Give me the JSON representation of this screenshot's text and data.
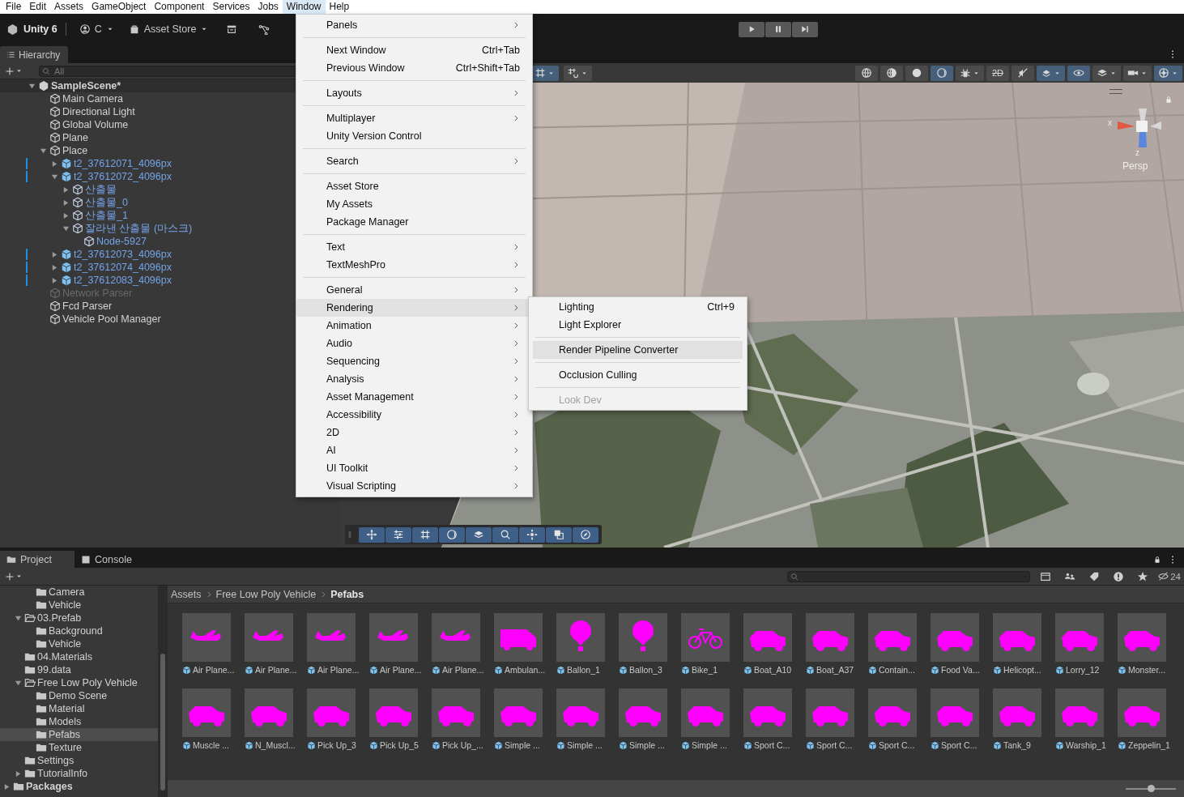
{
  "menubar": [
    {
      "label": "File",
      "selected": false
    },
    {
      "label": "Edit",
      "selected": false
    },
    {
      "label": "Assets",
      "selected": false
    },
    {
      "label": "GameObject",
      "selected": false
    },
    {
      "label": "Component",
      "selected": false
    },
    {
      "label": "Services",
      "selected": false
    },
    {
      "label": "Jobs",
      "selected": false
    },
    {
      "label": "Window",
      "selected": true
    },
    {
      "label": "Help",
      "selected": false
    }
  ],
  "toolbar": {
    "product": "Unity 6",
    "account": "C",
    "store": "Asset Store",
    "playback": [
      {
        "kind": "play",
        "selected": false
      },
      {
        "kind": "pause",
        "selected": false
      },
      {
        "kind": "step",
        "selected": false
      }
    ]
  },
  "hierarchy": {
    "title": "Hierarchy",
    "search": {
      "placeholder": "All"
    },
    "tree": [
      {
        "label": "SampleScene*",
        "kind": "scene",
        "expanded": true,
        "children": [
          {
            "label": "Main Camera",
            "kind": "object"
          },
          {
            "label": "Directional Light",
            "kind": "object"
          },
          {
            "label": "Global Volume",
            "kind": "object"
          },
          {
            "label": "Plane",
            "kind": "object"
          },
          {
            "label": "Place",
            "kind": "object",
            "expanded": true,
            "children": [
              {
                "label": "t2_37612071_4096px",
                "kind": "prefab",
                "expanded": false
              },
              {
                "label": "t2_37612072_4096px",
                "kind": "prefab",
                "expanded": true,
                "children": [
                  {
                    "label": "산출물",
                    "kind": "prefab-part",
                    "expanded": false
                  },
                  {
                    "label": "산출물_0",
                    "kind": "prefab-part",
                    "expanded": false
                  },
                  {
                    "label": "산출물_1",
                    "kind": "prefab-part",
                    "expanded": false
                  },
                  {
                    "label": "잘라낸 산출물 (마스크)",
                    "kind": "prefab-part",
                    "expanded": true,
                    "children": [
                      {
                        "label": "Node-5927",
                        "kind": "prefab-part"
                      }
                    ]
                  }
                ]
              },
              {
                "label": "t2_37612073_4096px",
                "kind": "prefab",
                "expanded": false
              },
              {
                "label": "t2_37612074_4096px",
                "kind": "prefab",
                "expanded": false
              },
              {
                "label": "t2_37612083_4096px",
                "kind": "prefab",
                "expanded": false
              }
            ]
          },
          {
            "label": "Network Parser",
            "kind": "inactive"
          },
          {
            "label": "Fcd Parser",
            "kind": "object"
          },
          {
            "label": "Vehicle Pool Manager",
            "kind": "object"
          }
        ]
      }
    ]
  },
  "scene": {
    "tools_left": [
      {
        "kind": "grid",
        "selected": true
      },
      {
        "kind": "snap",
        "selected": false
      }
    ],
    "tools_right": [
      {
        "kind": "globe",
        "selected": false
      },
      {
        "kind": "globe-half",
        "selected": false
      },
      {
        "kind": "sphere",
        "selected": false
      },
      {
        "kind": "moon",
        "selected": true
      },
      {
        "kind": "bug",
        "selected": false,
        "dropdown": true
      },
      {
        "kind": "label",
        "label": "2D",
        "selected": false
      },
      {
        "kind": "mute",
        "selected": false
      },
      {
        "kind": "effects",
        "selected": true,
        "dropdown": true
      },
      {
        "kind": "eye",
        "selected": true
      },
      {
        "kind": "layers",
        "selected": false,
        "dropdown": true
      },
      {
        "kind": "camera",
        "selected": false,
        "dropdown": true
      },
      {
        "kind": "gizmo",
        "selected": true,
        "dropdown": true
      }
    ],
    "gizmo": {
      "x_label": "x",
      "z_label": "z",
      "view": "Persp"
    },
    "overlay_tools": [
      {
        "kind": "move"
      },
      {
        "kind": "sliders"
      },
      {
        "kind": "grid"
      },
      {
        "kind": "moon"
      },
      {
        "kind": "layers"
      },
      {
        "kind": "search"
      },
      {
        "kind": "nodes"
      },
      {
        "kind": "stack"
      },
      {
        "kind": "compass"
      }
    ]
  },
  "window_menu": {
    "items": [
      {
        "kind": "item",
        "label": "Panels",
        "submenu": true,
        "selected": false
      },
      {
        "kind": "separator"
      },
      {
        "kind": "item",
        "label": "Next Window",
        "shortcut": "Ctrl+Tab",
        "submenu": false,
        "selected": false
      },
      {
        "kind": "item",
        "label": "Previous Window",
        "shortcut": "Ctrl+Shift+Tab",
        "submenu": false,
        "selected": false
      },
      {
        "kind": "separator"
      },
      {
        "kind": "item",
        "label": "Layouts",
        "submenu": true,
        "selected": false
      },
      {
        "kind": "separator"
      },
      {
        "kind": "item",
        "label": "Multiplayer",
        "submenu": true,
        "selected": false
      },
      {
        "kind": "item",
        "label": "Unity Version Control",
        "submenu": false,
        "selected": false
      },
      {
        "kind": "separator"
      },
      {
        "kind": "item",
        "label": "Search",
        "submenu": true,
        "selected": false
      },
      {
        "kind": "separator"
      },
      {
        "kind": "item",
        "label": "Asset Store",
        "submenu": false,
        "selected": false
      },
      {
        "kind": "item",
        "label": "My Assets",
        "submenu": false,
        "selected": false
      },
      {
        "kind": "item",
        "label": "Package Manager",
        "submenu": false,
        "selected": false
      },
      {
        "kind": "separator"
      },
      {
        "kind": "item",
        "label": "Text",
        "submenu": true,
        "selected": false
      },
      {
        "kind": "item",
        "label": "TextMeshPro",
        "submenu": true,
        "selected": false
      },
      {
        "kind": "separator"
      },
      {
        "kind": "item",
        "label": "General",
        "submenu": true,
        "selected": false
      },
      {
        "kind": "item",
        "label": "Rendering",
        "submenu": true,
        "selected": true
      },
      {
        "kind": "item",
        "label": "Animation",
        "submenu": true,
        "selected": false
      },
      {
        "kind": "item",
        "label": "Audio",
        "submenu": true,
        "selected": false
      },
      {
        "kind": "item",
        "label": "Sequencing",
        "submenu": true,
        "selected": false
      },
      {
        "kind": "item",
        "label": "Analysis",
        "submenu": true,
        "selected": false
      },
      {
        "kind": "item",
        "label": "Asset Management",
        "submenu": true,
        "selected": false
      },
      {
        "kind": "item",
        "label": "Accessibility",
        "submenu": true,
        "selected": false
      },
      {
        "kind": "item",
        "label": "2D",
        "submenu": true,
        "selected": false
      },
      {
        "kind": "item",
        "label": "AI",
        "submenu": true,
        "selected": false
      },
      {
        "kind": "item",
        "label": "UI Toolkit",
        "submenu": true,
        "selected": false
      },
      {
        "kind": "item",
        "label": "Visual Scripting",
        "submenu": true,
        "selected": false
      }
    ]
  },
  "rendering_submenu": {
    "items": [
      {
        "kind": "item",
        "label": "Lighting",
        "shortcut": "Ctrl+9",
        "selected": false,
        "disabled": false
      },
      {
        "kind": "item",
        "label": "Light Explorer",
        "selected": false,
        "disabled": false
      },
      {
        "kind": "separator"
      },
      {
        "kind": "item",
        "label": "Render Pipeline Converter",
        "selected": true,
        "disabled": false
      },
      {
        "kind": "separator"
      },
      {
        "kind": "item",
        "label": "Occlusion Culling",
        "selected": false,
        "disabled": false
      },
      {
        "kind": "separator"
      },
      {
        "kind": "item",
        "label": "Look Dev",
        "selected": false,
        "disabled": true
      }
    ]
  },
  "project": {
    "tabs": [
      {
        "label": "Project",
        "kind": "folder",
        "selected": true
      },
      {
        "label": "Console",
        "kind": "console",
        "selected": false
      }
    ],
    "tree": [
      {
        "children": [
          {
            "children": [
              {
                "label": "Camera"
              },
              {
                "label": "Vehicle"
              }
            ]
          },
          {
            "label": "03.Prefab",
            "expanded": true,
            "children": [
              {
                "label": "Background"
              },
              {
                "label": "Vehicle"
              }
            ]
          },
          {
            "label": "04.Materials"
          },
          {
            "label": "99.data"
          },
          {
            "label": "Free Low Poly Vehicle",
            "expanded": true,
            "children": [
              {
                "label": "Demo Scene"
              },
              {
                "label": "Material"
              },
              {
                "label": "Models"
              },
              {
                "label": "Pefabs",
                "selected": true
              },
              {
                "label": "Texture"
              }
            ]
          },
          {
            "label": "Settings"
          },
          {
            "label": "TutorialInfo",
            "expanded": false
          }
        ]
      },
      {
        "label": "Packages",
        "expanded": false,
        "bold": true
      }
    ],
    "breadcrumb": [
      "Assets",
      "Free Low Poly Vehicle",
      "Pefabs"
    ],
    "count": "24",
    "assets": [
      "Air Plane...",
      "Air Plane...",
      "Air Plane...",
      "Air Plane...",
      "Air Plane...",
      "Ambulan...",
      "Ballon_1",
      "Ballon_3",
      "Bike_1",
      "Boat_A10",
      "Boat_A37",
      "Contain...",
      "Food Va...",
      "Helicopt...",
      "Lorry_12",
      "Monster...",
      "Muscle ...",
      "N_Muscl...",
      "Pick Up_3",
      "Pick Up_5",
      "Pick Up_...",
      "Simple ...",
      "Simple ...",
      "Simple ...",
      "Simple ...",
      "Sport C...",
      "Sport C...",
      "Sport C...",
      "Sport C...",
      "Tank_9",
      "Warship_1",
      "Zeppelin_1"
    ],
    "zoom": {
      "level": 0.5
    }
  }
}
